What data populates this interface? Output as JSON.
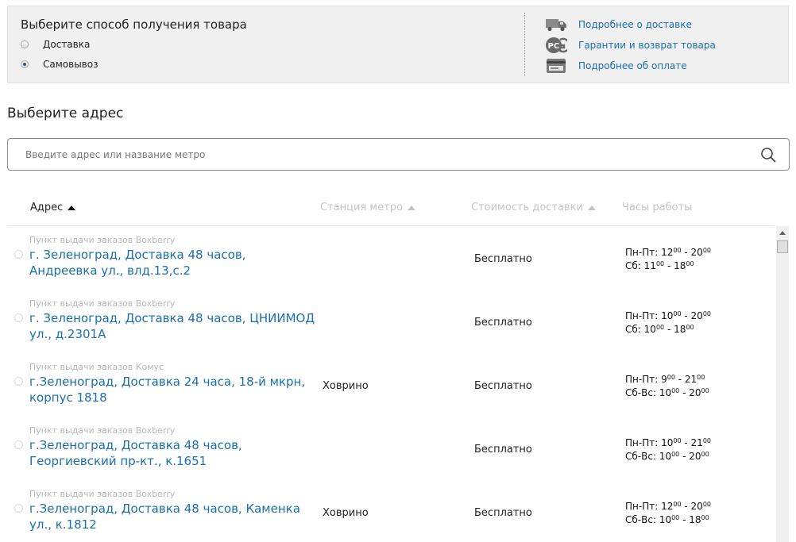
{
  "delivery_method": {
    "title": "Выберите способ получения товара",
    "options": [
      {
        "label": "Доставка",
        "selected": false
      },
      {
        "label": "Самовывоз",
        "selected": true
      }
    ]
  },
  "info_links": [
    {
      "label": "Подробнее о доставке",
      "icon": "truck-icon"
    },
    {
      "label": "Гарантии и возврат товара",
      "icon": "pct-certification-icon"
    },
    {
      "label": "Подробнее об оплате",
      "icon": "payment-card-icon"
    }
  ],
  "address_section": {
    "title": "Выберите адрес",
    "search_placeholder": "Введите адрес или название метро"
  },
  "table": {
    "headers": [
      "Адрес",
      "Станция метро",
      "Стоимость доставки",
      "Часы работы"
    ],
    "active_sort": "Адрес",
    "rows": [
      {
        "provider": "Пункт выдачи заказов Boxberry",
        "address": "г. Зеленоград, Доставка 48 часов, Андреевка ул., влд.13,с.2",
        "metro": "",
        "cost": "Бесплатно",
        "hours": [
          {
            "days": "Пн-Пт:",
            "from_h": "12",
            "from_m": "00",
            "to_h": "20",
            "to_m": "00"
          },
          {
            "days": "Сб:",
            "from_h": "11",
            "from_m": "00",
            "to_h": "18",
            "to_m": "00"
          }
        ]
      },
      {
        "provider": "Пункт выдачи заказов Boxberry",
        "address": "г. Зеленоград, Доставка 48 часов, ЦНИИМОД ул., д.2301А",
        "metro": "",
        "cost": "Бесплатно",
        "hours": [
          {
            "days": "Пн-Пт:",
            "from_h": "10",
            "from_m": "00",
            "to_h": "20",
            "to_m": "00"
          },
          {
            "days": "Сб:",
            "from_h": "10",
            "from_m": "00",
            "to_h": "18",
            "to_m": "00"
          }
        ]
      },
      {
        "provider": "Пункт выдачи заказов Комус",
        "address": "г.Зеленоград, Доставка 24 часа, 18-й мкрн, корпус 1818",
        "metro": "Ховрино",
        "cost": "Бесплатно",
        "hours": [
          {
            "days": "Пн-Пт:",
            "from_h": "9",
            "from_m": "00",
            "to_h": "21",
            "to_m": "00"
          },
          {
            "days": "Сб-Вс:",
            "from_h": "10",
            "from_m": "00",
            "to_h": "20",
            "to_m": "00"
          }
        ]
      },
      {
        "provider": "Пункт выдачи заказов Boxberry",
        "address": "г.Зеленоград, Доставка 48 часов, Георгиевский пр-кт., к.1651",
        "metro": "",
        "cost": "Бесплатно",
        "hours": [
          {
            "days": "Пн-Пт:",
            "from_h": "10",
            "from_m": "00",
            "to_h": "21",
            "to_m": "00"
          },
          {
            "days": "Сб-Вс:",
            "from_h": "10",
            "from_m": "00",
            "to_h": "20",
            "to_m": "00"
          }
        ]
      },
      {
        "provider": "Пункт выдачи заказов Boxberry",
        "address": "г.Зеленоград, Доставка 48 часов, Каменка ул., к.1812",
        "metro": "Ховрино",
        "cost": "Бесплатно",
        "hours": [
          {
            "days": "Пн-Пт:",
            "from_h": "12",
            "from_m": "00",
            "to_h": "20",
            "to_m": "00"
          },
          {
            "days": "Сб-Вс:",
            "from_h": "10",
            "from_m": "00",
            "to_h": "18",
            "to_m": "00"
          }
        ]
      }
    ]
  },
  "colors": {
    "link": "#1a6fb0",
    "panel_bg": "#f0f0f0",
    "muted": "#c4c4c4"
  }
}
